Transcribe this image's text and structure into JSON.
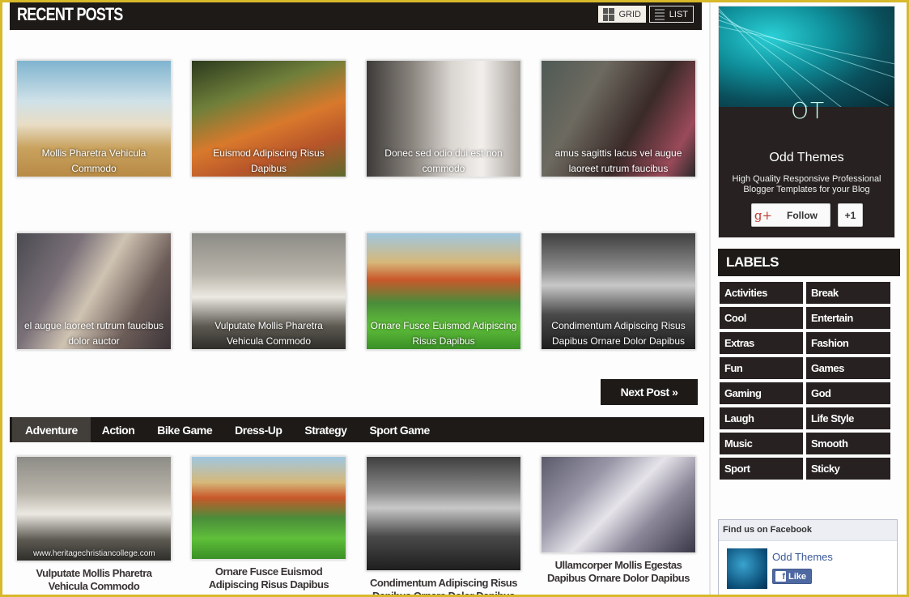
{
  "recent": {
    "title": "RECENT POSTS",
    "view_grid": "GRID",
    "view_list": "LIST",
    "posts": [
      {
        "caption": "Mollis Pharetra Vehicula Commodo",
        "image": "beach-couple-dog"
      },
      {
        "caption": "Euismod Adipiscing Risus Dapibus",
        "image": "woman-autumn-field"
      },
      {
        "caption": "Donec sed odio dui est non commodo",
        "image": "fashion-shoot-studio"
      },
      {
        "caption": "amus sagittis lacus vel augue laoreet rutrum faucibus",
        "image": "couple-against-wall"
      },
      {
        "caption": "el augue laoreet rutrum faucibus dolor auctor",
        "image": "group-fashion-women"
      },
      {
        "caption": "Vulputate Mollis Pharetra Vehicula Commodo",
        "image": "woman-vintage-car"
      },
      {
        "caption": "Ornare Fusce Euismod Adipiscing Risus Dapibus",
        "image": "golf-course-sunset"
      },
      {
        "caption": "Condimentum Adipiscing Risus Dapibus Ornare Dolor Dapibus",
        "image": "woman-umbrella-car"
      }
    ],
    "next_label": "Next Post »"
  },
  "category_tabs": {
    "items": [
      "Adventure",
      "Action",
      "Bike Game",
      "Dress-Up",
      "Strategy",
      "Sport Game"
    ],
    "active": "Adventure",
    "posts": [
      {
        "title": "Vulputate Mollis Pharetra Vehicula Commodo",
        "image": "woman-vintage-car",
        "watermark": "www.heritagechristiancollege.com"
      },
      {
        "title": "Ornare Fusce Euismod Adipiscing Risus Dapibus",
        "image": "golf-course-sunset"
      },
      {
        "title": "Condimentum Adipiscing Risus Dapibus Ornare Dolor Dapibus",
        "image": "woman-umbrella-car"
      },
      {
        "title": "Ullamcorper Mollis Egestas Dapibus Ornare Dolor Dapibus",
        "image": "woman-flowing-dress"
      }
    ]
  },
  "sidebar": {
    "profile": {
      "logo": "OT",
      "name": "Odd Themes",
      "description": "High Quality Responsive Professional Blogger Templates for your Blog",
      "follow_label": "Follow",
      "plus_one_label": "+1",
      "gplus_icon": "g+"
    },
    "labels": {
      "title": "LABELS",
      "items": [
        "Activities",
        "Break",
        "Cool",
        "Entertain",
        "Extras",
        "Fashion",
        "Fun",
        "Games",
        "Gaming",
        "God",
        "Laugh",
        "Life Style",
        "Music",
        "Smooth",
        "Sport",
        "Sticky"
      ]
    },
    "facebook": {
      "header": "Find us on Facebook",
      "page_name": "Odd Themes",
      "like_label": "Like",
      "f_icon": "f"
    }
  },
  "colors": {
    "dark": "#1d1a18",
    "frame": "#d7b92a",
    "tab_active": "#423e3a",
    "facebook": "#4e69a2"
  }
}
